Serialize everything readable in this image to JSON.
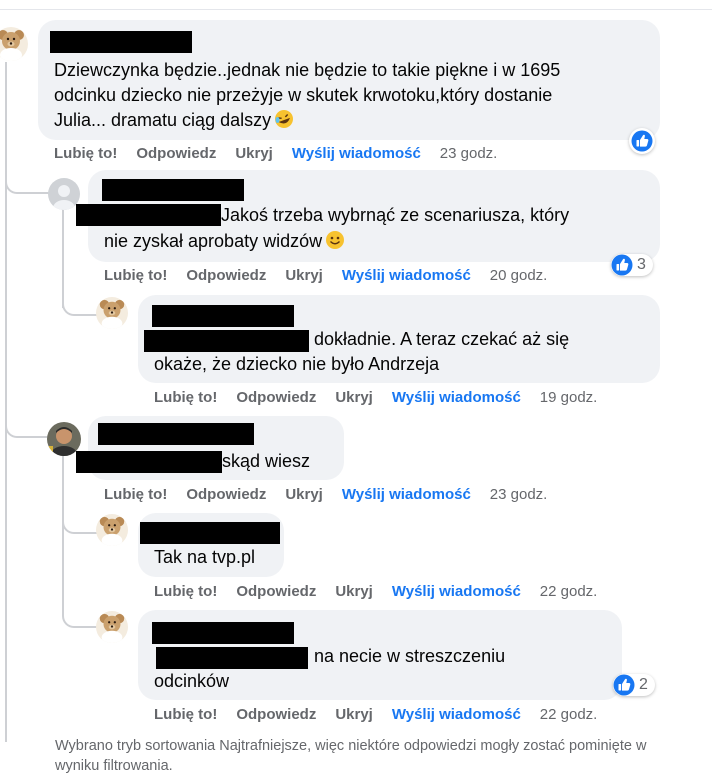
{
  "actions": {
    "like": "Lubię to!",
    "reply": "Odpowiedz",
    "hide": "Ukryj",
    "message": "Wyślij wiadomość"
  },
  "comments": [
    {
      "text_lines": [
        "Dziewczynka będzie..jednak nie będzie to takie piękne i w 1695",
        "odcinku dziecko nie przeżyje w skutek krwotoku,który dostanie",
        "Julia... dramatu ciąg dalszy"
      ],
      "emoji": "rofl-emoji",
      "time": "23 godz.",
      "reaction_icon": "like-icon"
    },
    {
      "text_lines": [
        "Jakoś trzeba wybrnąć ze scenariusza, który",
        "nie zyskał aprobaty widzów"
      ],
      "emoji": "smile-emoji",
      "time": "20 godz.",
      "reaction_icon": "like-icon",
      "reaction_count": "3"
    },
    {
      "text_lines": [
        "dokładnie. A teraz czekać aż się",
        "okaże, że dziecko nie było Andrzeja"
      ],
      "time": "19 godz."
    },
    {
      "text_lines": [
        "skąd wiesz"
      ],
      "time": "23 godz."
    },
    {
      "text_lines": [
        "Tak na tvp.pl"
      ],
      "time": "22 godz."
    },
    {
      "text_lines": [
        "na necie w streszczeniu",
        "odcinków"
      ],
      "time": "22 godz.",
      "reaction_icon": "like-icon",
      "reaction_count": "2"
    }
  ],
  "footer_text": "Wybrano tryb sortowania Najtrafniejsze, więc niektóre odpowiedzi mogły zostać pominięte w wyniku filtrowania.",
  "colors": {
    "bubble": "#f0f2f5",
    "link": "#1877f2",
    "secondary_text": "#65676b",
    "redaction": "#000000"
  }
}
